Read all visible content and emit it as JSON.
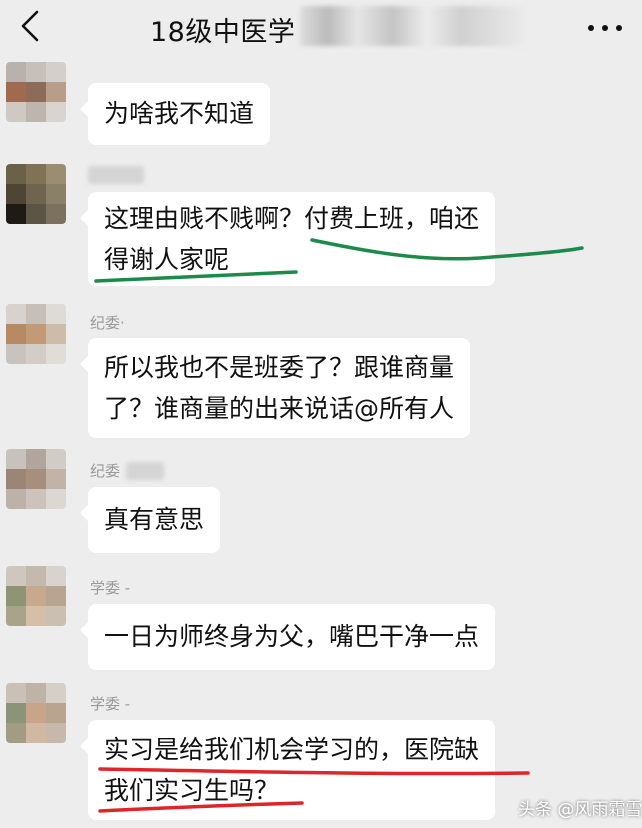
{
  "header": {
    "title": "18级中医学",
    "back_icon": "chevron-left-icon",
    "more_icon": "more-horizontal-icon"
  },
  "messages": [
    {
      "sender": "",
      "lines": [
        "为啥我不知道"
      ]
    },
    {
      "sender": "",
      "lines": [
        "这理由贱不贱啊？付费上班，咱还",
        "得谢人家呢"
      ]
    },
    {
      "sender": "纪委·",
      "lines": [
        "所以我也不是班委了？跟谁商量",
        "了？谁商量的出来说话@所有人"
      ]
    },
    {
      "sender": "纪委",
      "lines": [
        "真有意思"
      ]
    },
    {
      "sender": "学委 -",
      "lines": [
        "一日为师终身为父，嘴巴干净一点"
      ]
    },
    {
      "sender": "学委 -",
      "lines": [
        "实习是给我们机会学习的，医院缺",
        "我们实习生吗？"
      ]
    }
  ],
  "annotations": {
    "green": "#1c8a4a",
    "red": "#e0252a"
  },
  "watermark": {
    "text": "头条 @风雨霜雪"
  }
}
